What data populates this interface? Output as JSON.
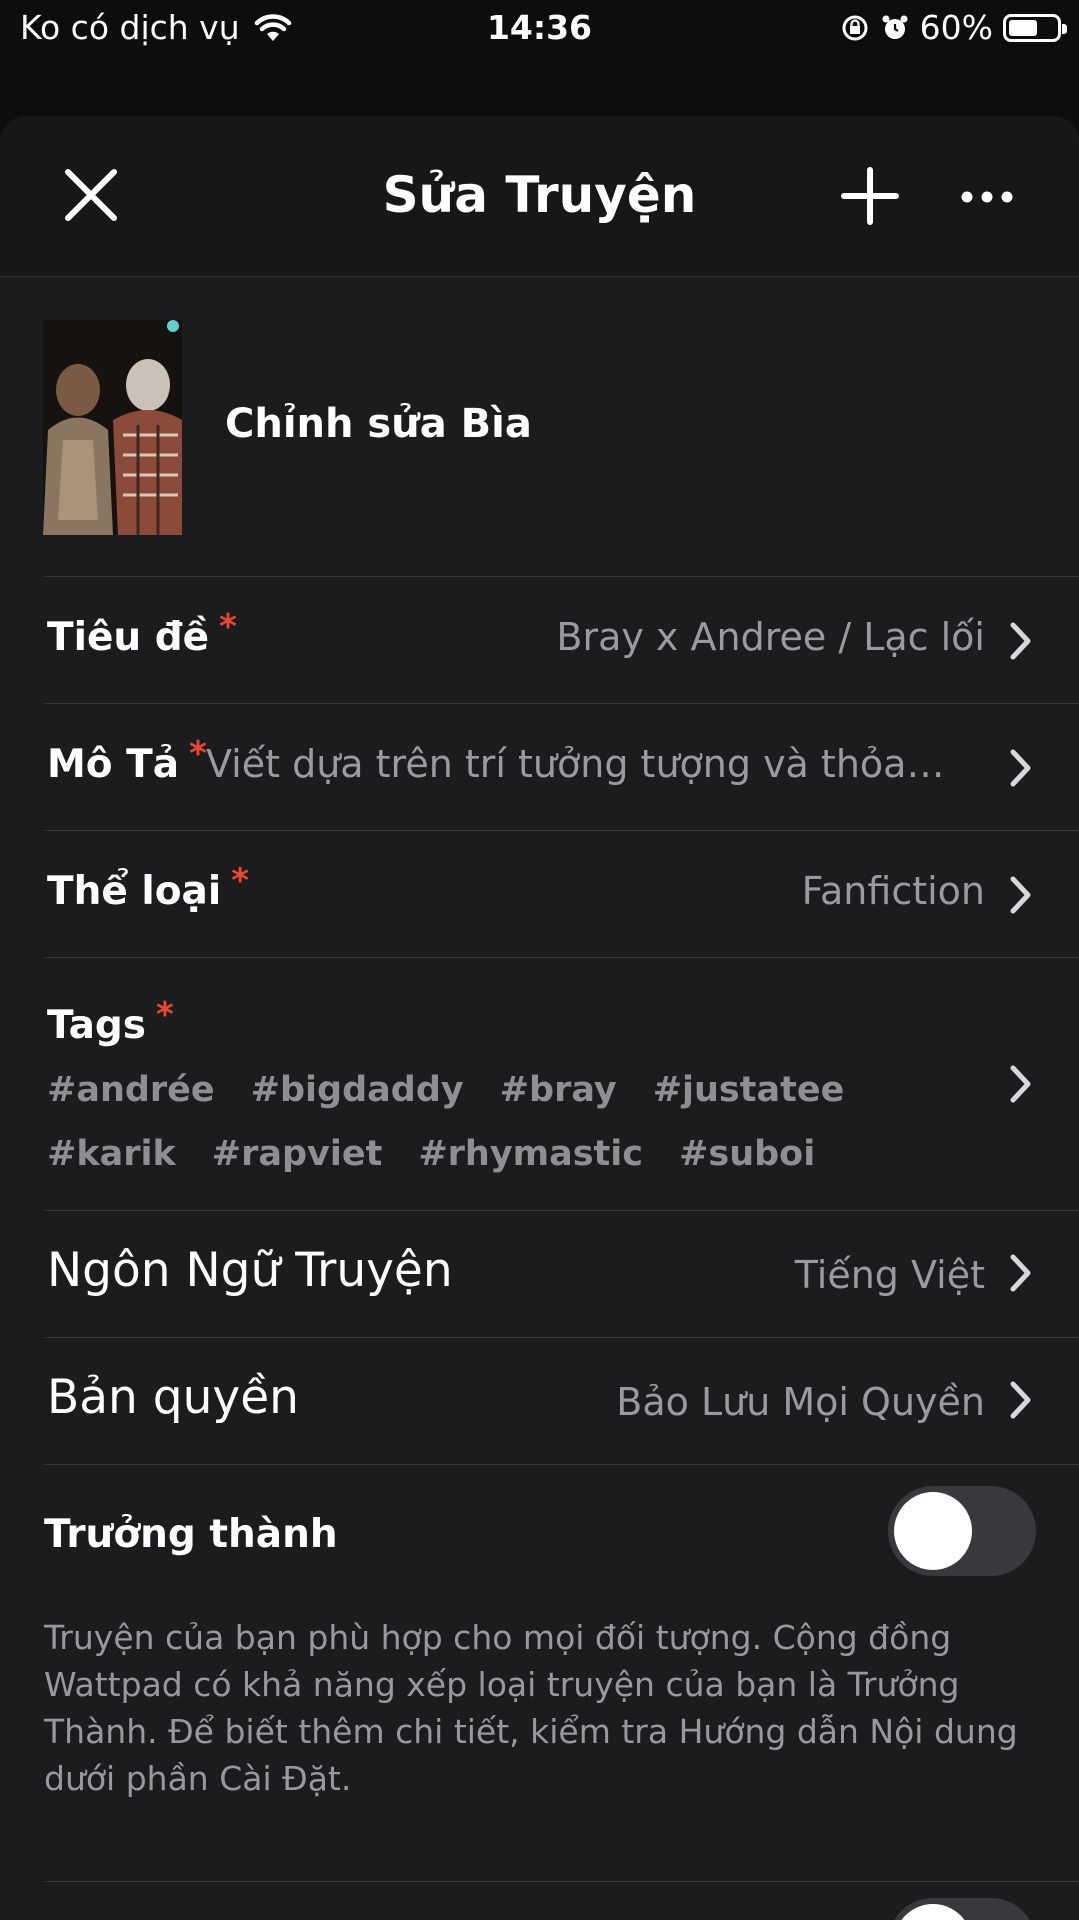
{
  "status_bar": {
    "carrier": "Ko có dịch vụ",
    "time": "14:36",
    "battery_percent": "60%",
    "battery_level": 0.6,
    "icons": [
      "wifi-icon",
      "orientation-lock-icon",
      "alarm-icon",
      "battery-icon"
    ]
  },
  "header": {
    "title": "Sửa Truyện",
    "close_icon": "close-icon",
    "add_icon": "plus-icon",
    "more_icon": "more-icon"
  },
  "cover": {
    "edit_label": "Chỉnh sửa Bìa"
  },
  "fields": {
    "title": {
      "label": "Tiêu đề",
      "required_mark": "*",
      "value": "Bray x Andree  /  Lạc lối"
    },
    "description": {
      "label": "Mô Tả",
      "required_mark": "*",
      "value": "Viết dựa trên trí tưởng tượng và thỏa mãn bản thân"
    },
    "genre": {
      "label": "Thể loại",
      "required_mark": "*",
      "value": "Fanfiction"
    },
    "tags": {
      "label": "Tags",
      "required_mark": "*",
      "items": [
        "#andrée",
        "#bigdaddy",
        "#bray",
        "#justatee",
        "#karik",
        "#rapviet",
        "#rhymastic",
        "#suboi"
      ]
    },
    "language": {
      "label": "Ngôn Ngữ Truyện",
      "value": "Tiếng Việt"
    },
    "copyright": {
      "label": "Bản quyền",
      "value": "Bảo Lưu Mọi Quyền"
    },
    "mature": {
      "label": "Trưởng thành",
      "enabled": false,
      "description": "Truyện của bạn phù hợp cho mọi đối tượng. Cộng đồng Wattpad có khả năng xếp loại truyện của bạn là Trưởng Thành. Để biết thêm chi tiết, kiểm tra Hướng dẫn Nội dung dưới phần Cài Đặt."
    }
  },
  "colors": {
    "background": "#1c1c1e",
    "required": "#e8492f",
    "secondary_text": "#9a9aa0"
  }
}
